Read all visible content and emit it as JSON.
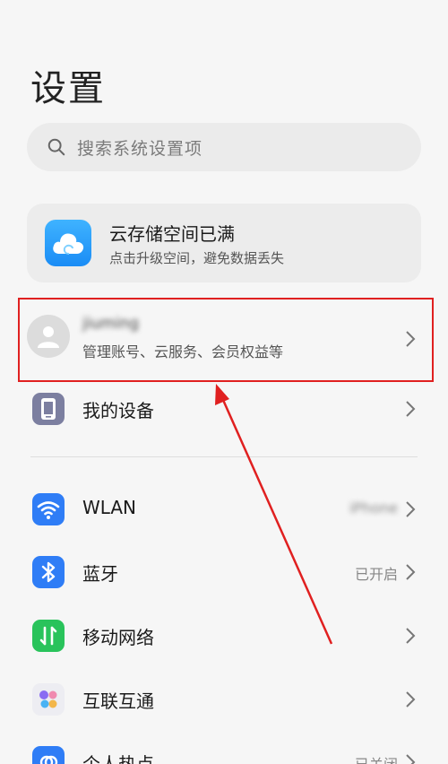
{
  "page": {
    "title": "设置"
  },
  "search": {
    "placeholder": "搜索系统设置项"
  },
  "cloud_card": {
    "title": "云存储空间已满",
    "subtitle": "点击升级空间，避免数据丢失"
  },
  "account": {
    "name": "jiuming",
    "subtitle": "管理账号、云服务、会员权益等"
  },
  "items": [
    {
      "label": "我的设备",
      "value": "",
      "icon": "device-icon"
    },
    {
      "label": "WLAN",
      "value": "iPhone",
      "icon": "wifi-icon"
    },
    {
      "label": "蓝牙",
      "value": "已开启",
      "icon": "bluetooth-icon"
    },
    {
      "label": "移动网络",
      "value": "",
      "icon": "mobile-network-icon"
    },
    {
      "label": "互联互通",
      "value": "",
      "icon": "interconnect-icon"
    },
    {
      "label": "个人热点",
      "value": "已关闭",
      "icon": "hotspot-icon"
    }
  ],
  "colors": {
    "highlight": "#e02020",
    "accent": "#2f7df6",
    "mobile_green": "#29c35b"
  }
}
